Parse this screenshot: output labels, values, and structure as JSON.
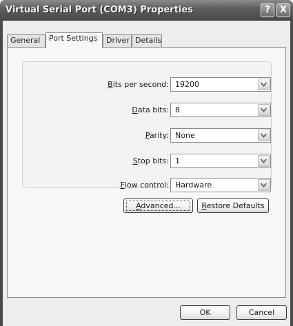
{
  "window": {
    "title": "Virtual Serial Port (COM3) Properties",
    "help_label": "?",
    "close_label": "X"
  },
  "tabs": [
    {
      "label": "General",
      "active": false
    },
    {
      "label": "Port Settings",
      "active": true
    },
    {
      "label": "Driver",
      "active": false
    },
    {
      "label": "Details",
      "active": false
    }
  ],
  "port_settings": {
    "fields": [
      {
        "label_access": "B",
        "label_rest": "its per second:",
        "value": "19200"
      },
      {
        "label_access": "D",
        "label_rest": "ata bits:",
        "value": "8"
      },
      {
        "label_access": "P",
        "label_rest": "arity:",
        "value": "None"
      },
      {
        "label_access": "S",
        "label_rest": "top bits:",
        "value": "1"
      },
      {
        "label_access": "F",
        "label_rest": "low control:",
        "value": "Hardware"
      }
    ],
    "advanced_access": "A",
    "advanced_rest": "dvanced...",
    "restore_access": "R",
    "restore_rest": "estore Defaults"
  },
  "footer": {
    "ok_label": "OK",
    "cancel_label": "Cancel"
  },
  "colors": {
    "titlebar": "#474747",
    "dialog_face": "#ededed",
    "panel_face": "#f7f7f7"
  }
}
